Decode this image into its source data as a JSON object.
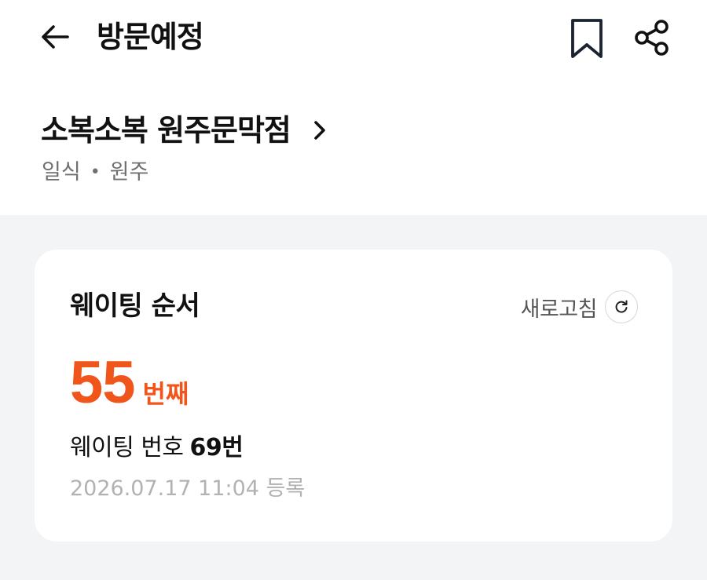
{
  "header": {
    "title": "방문예정",
    "back_icon": "arrow-left-icon",
    "bookmark_icon": "bookmark-icon",
    "share_icon": "share-icon"
  },
  "store": {
    "name": "소복소복 원주문막점",
    "category": "일식",
    "separator": "•",
    "location": "원주"
  },
  "card": {
    "title": "웨이팅 순서",
    "refresh_label": "새로고침",
    "rank_number": "55",
    "rank_unit": "번째",
    "waiting_label": "웨이팅 번호",
    "waiting_number": "69번",
    "registered": "2026.07.17 11:04 등록"
  },
  "colors": {
    "accent": "#f0561c",
    "background": "#f3f4f6",
    "card": "#ffffff"
  }
}
